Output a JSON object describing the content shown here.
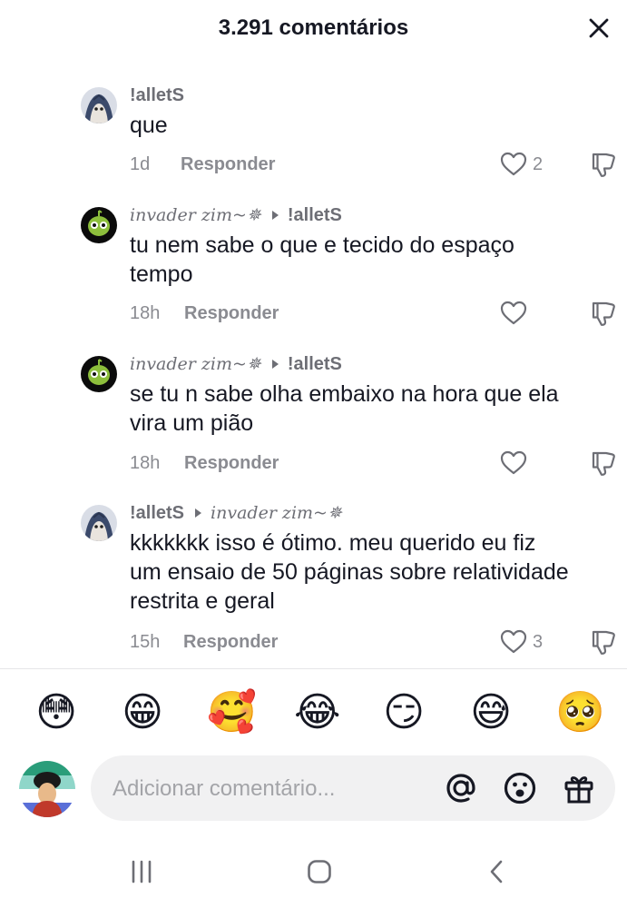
{
  "header": {
    "title": "3.291 comentários",
    "close_icon": "close-icon"
  },
  "comments": [
    {
      "author": "!alletS",
      "reply_to": "",
      "text": "que",
      "time": "1d",
      "reply_label": "Responder",
      "likes": "2"
    },
    {
      "author": "invader zim~✵",
      "reply_to": "!alletS",
      "text": "tu nem sabe o que e tecido do espaço tempo",
      "time": "18h",
      "reply_label": "Responder",
      "likes": ""
    },
    {
      "author": "invader zim~✵",
      "reply_to": "!alletS",
      "text": "se tu n sabe olha embaixo na hora que ela vira um pião",
      "time": "18h",
      "reply_label": "Responder",
      "likes": ""
    },
    {
      "author": "!alletS",
      "reply_to": "invader zim~✵",
      "text": "kkkkkkk isso é ótimo. meu querido eu fiz um ensaio de 50 páginas sobre relatividade restrita e geral",
      "time": "15h",
      "reply_label": "Responder",
      "likes": "3"
    }
  ],
  "emoji_bar": [
    "😳",
    "😁",
    "🥰",
    "😂",
    "😏",
    "😅",
    "🥺"
  ],
  "composer": {
    "placeholder": "Adicionar comentário...",
    "icons": [
      "at-icon",
      "emoji-icon",
      "gift-icon"
    ]
  },
  "nav": {
    "icons": [
      "recent-apps-icon",
      "home-icon",
      "back-icon"
    ]
  },
  "colors": {
    "text": "#161823",
    "muted": "#8a8b91",
    "input_bg": "#f1f1f2"
  }
}
